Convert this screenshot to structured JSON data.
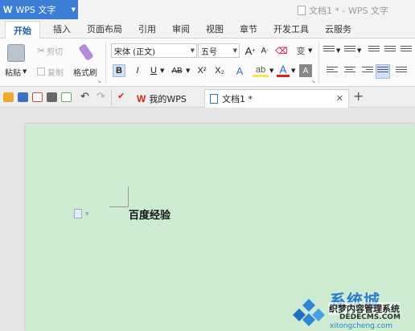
{
  "app": {
    "logo": "W",
    "name": "WPS 文字",
    "doc_title": "文档1 * - WPS 文字"
  },
  "tabs": [
    {
      "label": "开始",
      "active": true
    },
    {
      "label": "插入"
    },
    {
      "label": "页面布局"
    },
    {
      "label": "引用"
    },
    {
      "label": "审阅"
    },
    {
      "label": "视图"
    },
    {
      "label": "章节"
    },
    {
      "label": "开发工具"
    },
    {
      "label": "云服务"
    }
  ],
  "clipboard": {
    "paste_label": "粘贴",
    "cut_label": "剪切",
    "copy_label": "复制",
    "format_painter_label": "格式刷"
  },
  "font": {
    "family": "宋体 (正文)",
    "size": "五号",
    "bold": "B",
    "italic": "I",
    "underline": "U",
    "strike": "AB",
    "superscript": "X²",
    "subscript": "X₂",
    "grow": "A",
    "shrink": "A",
    "pinyin": "变",
    "effects": "A",
    "highlight": "ab",
    "color": "A",
    "shade": "A"
  },
  "doc_tabs": [
    {
      "label": "我的WPS",
      "active": false
    },
    {
      "label": "文档1 *",
      "active": true
    }
  ],
  "document": {
    "text": "百度经验"
  },
  "watermark": {
    "line1": "系统城",
    "line2": "织梦内容管理系统",
    "line3": "DEDECMS.COM",
    "line4": "xitongcheng.com"
  },
  "colors": {
    "accent": "#3c7dd6",
    "page_bg": "#cdebd0",
    "wps_red": "#d9241c"
  }
}
